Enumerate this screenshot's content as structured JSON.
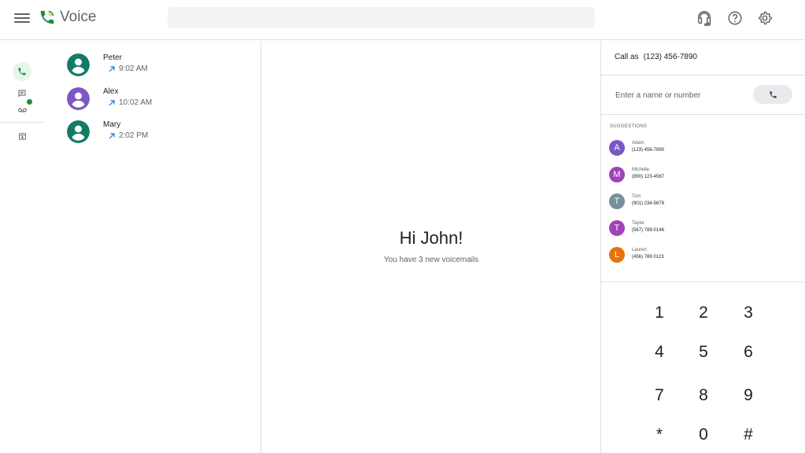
{
  "header": {
    "app_title": "Voice",
    "search": {
      "value": "",
      "placeholder": ""
    },
    "icons": [
      "headset-icon",
      "help-icon",
      "settings-icon"
    ],
    "brand_color": "#1e8e3e"
  },
  "rail": {
    "items": [
      {
        "icon": "phone-icon",
        "active": true
      },
      {
        "icon": "message-icon",
        "active": false
      },
      {
        "icon": "voicemail-icon",
        "active": false,
        "badge": true
      },
      {
        "icon": "archive-icon",
        "active": false
      }
    ]
  },
  "calls": [
    {
      "name": "Peter",
      "time": "9:02 AM",
      "avatar_color": "#137b65",
      "direction": "outgoing"
    },
    {
      "name": "Alex",
      "time": "10:02 AM",
      "avatar_color": "#7b57c4",
      "direction": "outgoing"
    },
    {
      "name": "Mary",
      "time": "2:02 PM",
      "avatar_color": "#137b65",
      "direction": "outgoing"
    }
  ],
  "main": {
    "greeting": "Hi John!",
    "subtitle": "You have 3 new voicemails"
  },
  "dialer": {
    "call_as_label": "Call as",
    "call_as_number": "(123) 456-7890",
    "input": {
      "value": "",
      "placeholder": "Enter a name or number"
    },
    "suggestions_title": "SUGGESTIONS",
    "suggestions": [
      {
        "initial": "A",
        "name": "Adam",
        "phone": "(123) 456-7890",
        "color": "#7b57c4"
      },
      {
        "initial": "M",
        "name": "Michelle",
        "phone": "(890) 123-4567",
        "color": "#a142b8"
      },
      {
        "initial": "T",
        "name": "Tom",
        "phone": "(901) 234-5678",
        "color": "#78909c"
      },
      {
        "initial": "T",
        "name": "Taylor",
        "phone": "(567) 789-0146",
        "color": "#a142b8"
      },
      {
        "initial": "L",
        "name": "Lauren",
        "phone": "(456) 789 0123",
        "color": "#e8710a"
      }
    ],
    "keys": [
      "1",
      "2",
      "3",
      "4",
      "5",
      "6",
      "7",
      "8",
      "9",
      "*",
      "0",
      "#"
    ]
  }
}
